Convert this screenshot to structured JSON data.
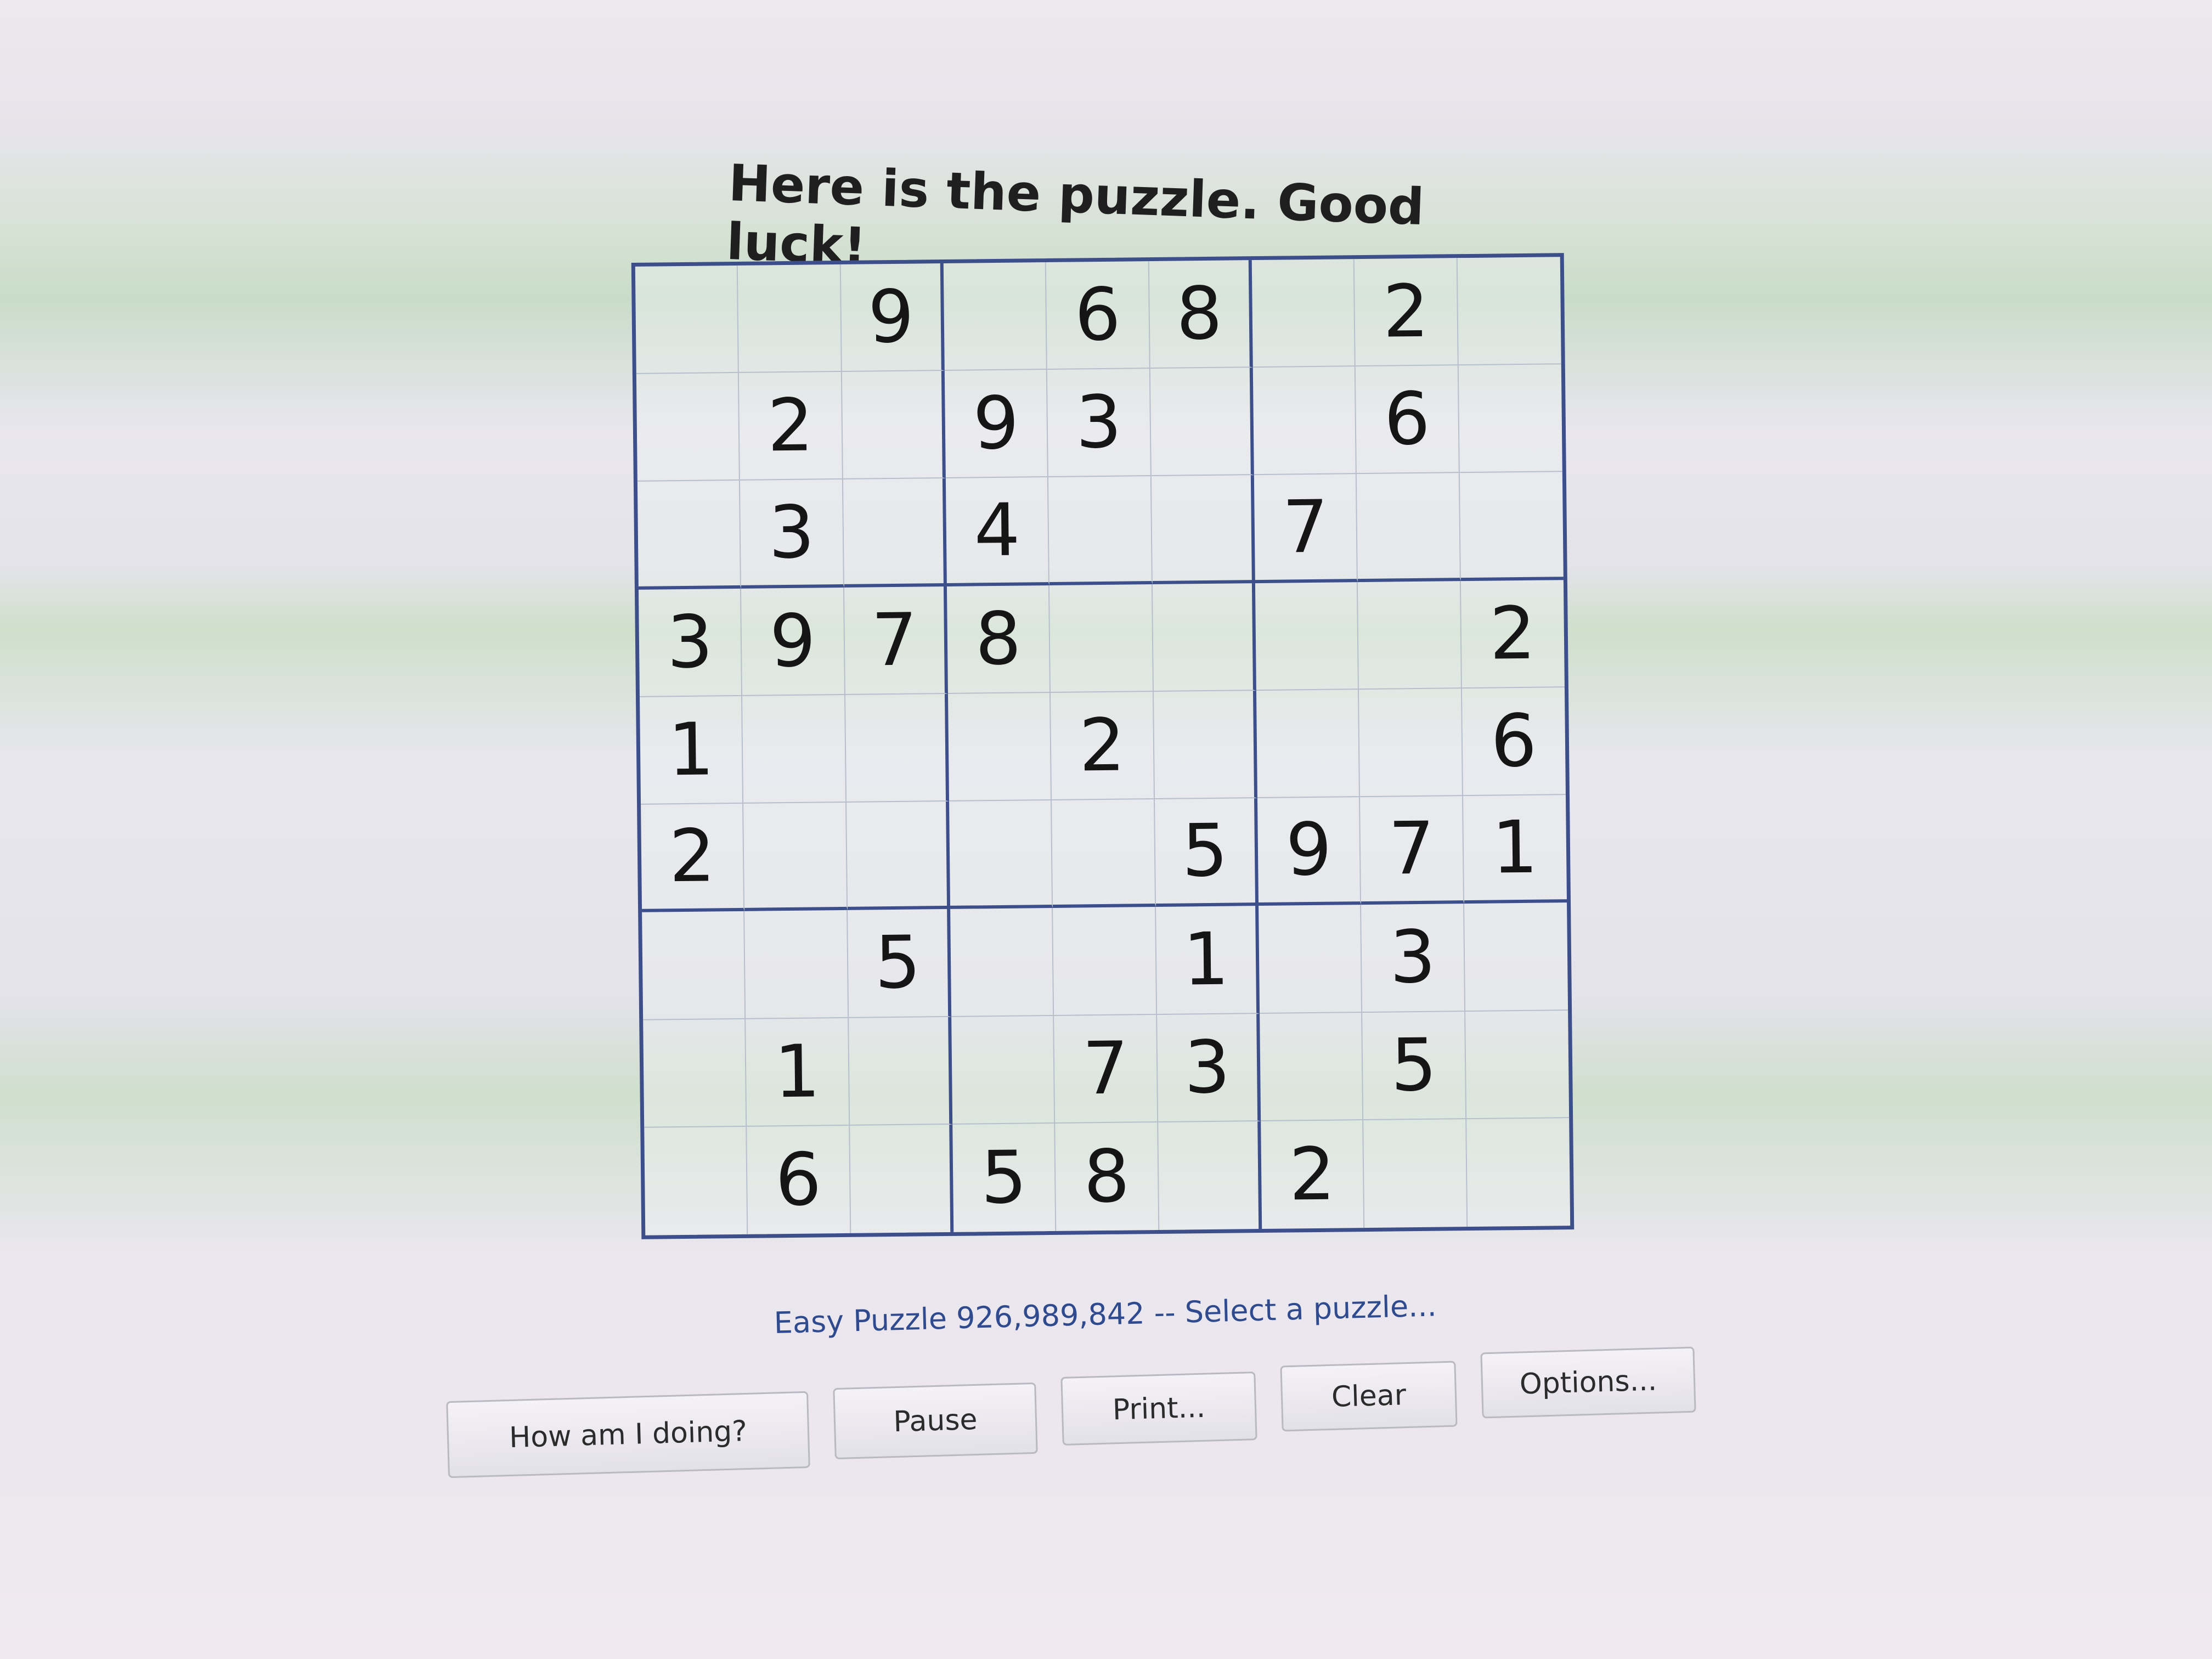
{
  "title": "Here is the puzzle. Good luck!",
  "grid": [
    [
      "",
      "",
      "9",
      "",
      "6",
      "8",
      "",
      "2",
      ""
    ],
    [
      "",
      "2",
      "",
      "9",
      "3",
      "",
      "",
      "6",
      ""
    ],
    [
      "",
      "3",
      "",
      "4",
      "",
      "",
      "7",
      "",
      ""
    ],
    [
      "3",
      "9",
      "7",
      "8",
      "",
      "",
      "",
      "",
      "2"
    ],
    [
      "1",
      "",
      "",
      "",
      "2",
      "",
      "",
      "",
      "6"
    ],
    [
      "2",
      "",
      "",
      "",
      "",
      "5",
      "9",
      "7",
      "1"
    ],
    [
      "",
      "",
      "5",
      "",
      "",
      "1",
      "",
      "3",
      ""
    ],
    [
      "",
      "1",
      "",
      "",
      "7",
      "3",
      "",
      "5",
      ""
    ],
    [
      "",
      "6",
      "",
      "5",
      "8",
      "",
      "2",
      "",
      ""
    ]
  ],
  "status": "Easy Puzzle 926,989,842 -- Select a puzzle...",
  "buttons": {
    "how_am_i_doing": "How am I doing?",
    "pause": "Pause",
    "print": "Print...",
    "clear": "Clear",
    "options": "Options..."
  },
  "colors": {
    "grid_border": "#3d4f8a",
    "status_text": "#2f4b8e"
  }
}
